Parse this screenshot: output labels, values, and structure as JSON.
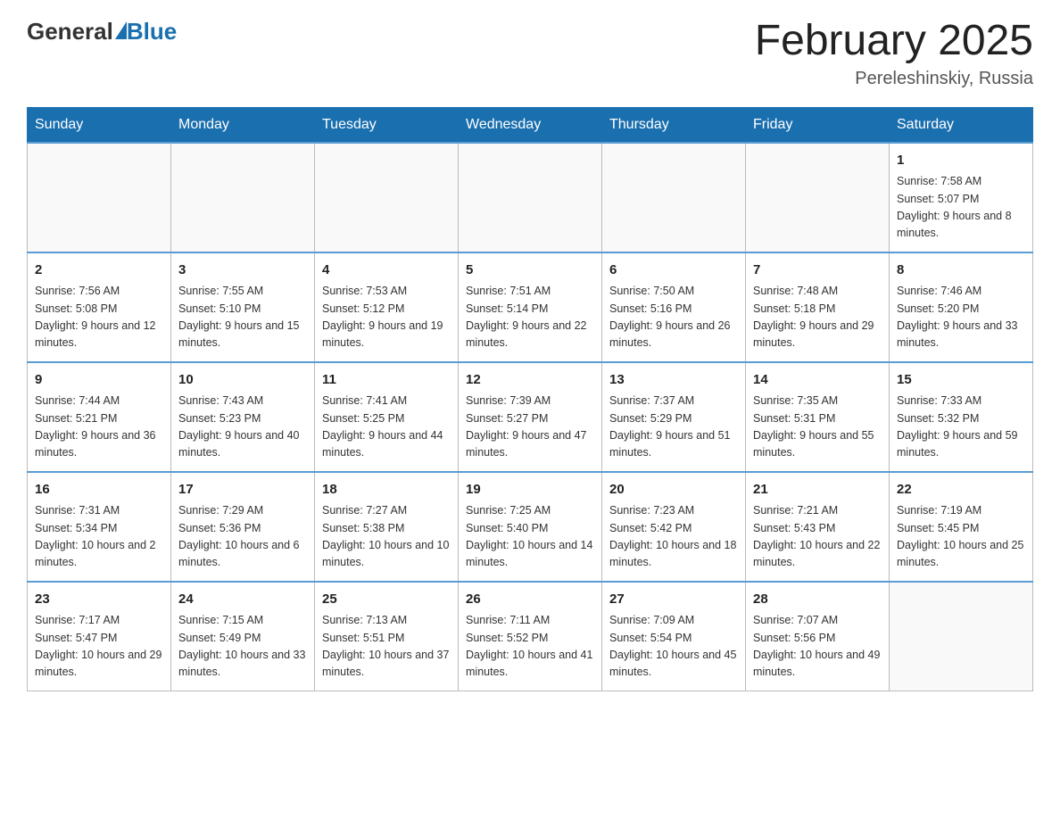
{
  "header": {
    "logo_general": "General",
    "logo_blue": "Blue",
    "month_title": "February 2025",
    "location": "Pereleshinskiy, Russia"
  },
  "days_of_week": [
    "Sunday",
    "Monday",
    "Tuesday",
    "Wednesday",
    "Thursday",
    "Friday",
    "Saturday"
  ],
  "weeks": [
    [
      {
        "day": "",
        "sunrise": "",
        "sunset": "",
        "daylight": ""
      },
      {
        "day": "",
        "sunrise": "",
        "sunset": "",
        "daylight": ""
      },
      {
        "day": "",
        "sunrise": "",
        "sunset": "",
        "daylight": ""
      },
      {
        "day": "",
        "sunrise": "",
        "sunset": "",
        "daylight": ""
      },
      {
        "day": "",
        "sunrise": "",
        "sunset": "",
        "daylight": ""
      },
      {
        "day": "",
        "sunrise": "",
        "sunset": "",
        "daylight": ""
      },
      {
        "day": "1",
        "sunrise": "Sunrise: 7:58 AM",
        "sunset": "Sunset: 5:07 PM",
        "daylight": "Daylight: 9 hours and 8 minutes."
      }
    ],
    [
      {
        "day": "2",
        "sunrise": "Sunrise: 7:56 AM",
        "sunset": "Sunset: 5:08 PM",
        "daylight": "Daylight: 9 hours and 12 minutes."
      },
      {
        "day": "3",
        "sunrise": "Sunrise: 7:55 AM",
        "sunset": "Sunset: 5:10 PM",
        "daylight": "Daylight: 9 hours and 15 minutes."
      },
      {
        "day": "4",
        "sunrise": "Sunrise: 7:53 AM",
        "sunset": "Sunset: 5:12 PM",
        "daylight": "Daylight: 9 hours and 19 minutes."
      },
      {
        "day": "5",
        "sunrise": "Sunrise: 7:51 AM",
        "sunset": "Sunset: 5:14 PM",
        "daylight": "Daylight: 9 hours and 22 minutes."
      },
      {
        "day": "6",
        "sunrise": "Sunrise: 7:50 AM",
        "sunset": "Sunset: 5:16 PM",
        "daylight": "Daylight: 9 hours and 26 minutes."
      },
      {
        "day": "7",
        "sunrise": "Sunrise: 7:48 AM",
        "sunset": "Sunset: 5:18 PM",
        "daylight": "Daylight: 9 hours and 29 minutes."
      },
      {
        "day": "8",
        "sunrise": "Sunrise: 7:46 AM",
        "sunset": "Sunset: 5:20 PM",
        "daylight": "Daylight: 9 hours and 33 minutes."
      }
    ],
    [
      {
        "day": "9",
        "sunrise": "Sunrise: 7:44 AM",
        "sunset": "Sunset: 5:21 PM",
        "daylight": "Daylight: 9 hours and 36 minutes."
      },
      {
        "day": "10",
        "sunrise": "Sunrise: 7:43 AM",
        "sunset": "Sunset: 5:23 PM",
        "daylight": "Daylight: 9 hours and 40 minutes."
      },
      {
        "day": "11",
        "sunrise": "Sunrise: 7:41 AM",
        "sunset": "Sunset: 5:25 PM",
        "daylight": "Daylight: 9 hours and 44 minutes."
      },
      {
        "day": "12",
        "sunrise": "Sunrise: 7:39 AM",
        "sunset": "Sunset: 5:27 PM",
        "daylight": "Daylight: 9 hours and 47 minutes."
      },
      {
        "day": "13",
        "sunrise": "Sunrise: 7:37 AM",
        "sunset": "Sunset: 5:29 PM",
        "daylight": "Daylight: 9 hours and 51 minutes."
      },
      {
        "day": "14",
        "sunrise": "Sunrise: 7:35 AM",
        "sunset": "Sunset: 5:31 PM",
        "daylight": "Daylight: 9 hours and 55 minutes."
      },
      {
        "day": "15",
        "sunrise": "Sunrise: 7:33 AM",
        "sunset": "Sunset: 5:32 PM",
        "daylight": "Daylight: 9 hours and 59 minutes."
      }
    ],
    [
      {
        "day": "16",
        "sunrise": "Sunrise: 7:31 AM",
        "sunset": "Sunset: 5:34 PM",
        "daylight": "Daylight: 10 hours and 2 minutes."
      },
      {
        "day": "17",
        "sunrise": "Sunrise: 7:29 AM",
        "sunset": "Sunset: 5:36 PM",
        "daylight": "Daylight: 10 hours and 6 minutes."
      },
      {
        "day": "18",
        "sunrise": "Sunrise: 7:27 AM",
        "sunset": "Sunset: 5:38 PM",
        "daylight": "Daylight: 10 hours and 10 minutes."
      },
      {
        "day": "19",
        "sunrise": "Sunrise: 7:25 AM",
        "sunset": "Sunset: 5:40 PM",
        "daylight": "Daylight: 10 hours and 14 minutes."
      },
      {
        "day": "20",
        "sunrise": "Sunrise: 7:23 AM",
        "sunset": "Sunset: 5:42 PM",
        "daylight": "Daylight: 10 hours and 18 minutes."
      },
      {
        "day": "21",
        "sunrise": "Sunrise: 7:21 AM",
        "sunset": "Sunset: 5:43 PM",
        "daylight": "Daylight: 10 hours and 22 minutes."
      },
      {
        "day": "22",
        "sunrise": "Sunrise: 7:19 AM",
        "sunset": "Sunset: 5:45 PM",
        "daylight": "Daylight: 10 hours and 25 minutes."
      }
    ],
    [
      {
        "day": "23",
        "sunrise": "Sunrise: 7:17 AM",
        "sunset": "Sunset: 5:47 PM",
        "daylight": "Daylight: 10 hours and 29 minutes."
      },
      {
        "day": "24",
        "sunrise": "Sunrise: 7:15 AM",
        "sunset": "Sunset: 5:49 PM",
        "daylight": "Daylight: 10 hours and 33 minutes."
      },
      {
        "day": "25",
        "sunrise": "Sunrise: 7:13 AM",
        "sunset": "Sunset: 5:51 PM",
        "daylight": "Daylight: 10 hours and 37 minutes."
      },
      {
        "day": "26",
        "sunrise": "Sunrise: 7:11 AM",
        "sunset": "Sunset: 5:52 PM",
        "daylight": "Daylight: 10 hours and 41 minutes."
      },
      {
        "day": "27",
        "sunrise": "Sunrise: 7:09 AM",
        "sunset": "Sunset: 5:54 PM",
        "daylight": "Daylight: 10 hours and 45 minutes."
      },
      {
        "day": "28",
        "sunrise": "Sunrise: 7:07 AM",
        "sunset": "Sunset: 5:56 PM",
        "daylight": "Daylight: 10 hours and 49 minutes."
      },
      {
        "day": "",
        "sunrise": "",
        "sunset": "",
        "daylight": ""
      }
    ]
  ]
}
